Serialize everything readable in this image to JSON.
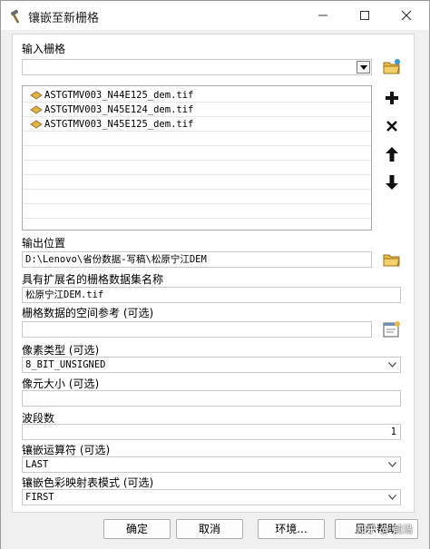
{
  "window": {
    "title": "镶嵌至新栅格",
    "minimize_symbol": "—",
    "maximize_symbol": "☐",
    "close_symbol": "✕"
  },
  "input_rasters": {
    "label": "输入栅格",
    "value": "",
    "items": [
      {
        "name": "ASTGTMV003_N44E125_dem.tif",
        "icon": "raster-layer-icon"
      },
      {
        "name": "ASTGTMV003_N45E124_dem.tif",
        "icon": "raster-layer-icon"
      },
      {
        "name": "ASTGTMV003_N45E125_dem.tif",
        "icon": "raster-layer-icon"
      }
    ]
  },
  "side_buttons": {
    "add": "+",
    "remove": "✕",
    "up": "↑",
    "down": "↓"
  },
  "output_location": {
    "label": "输出位置",
    "value": "D:\\Lenovo\\省份数据-写稿\\松原宁江DEM"
  },
  "output_name": {
    "label": "具有扩展名的栅格数据集名称",
    "value": "松原宁江DEM.tif"
  },
  "spatial_reference": {
    "label": "栅格数据的空间参考 (可选)",
    "value": ""
  },
  "pixel_type": {
    "label": "像素类型 (可选)",
    "value": "8_BIT_UNSIGNED"
  },
  "cellsize": {
    "label": "像元大小 (可选)",
    "value": ""
  },
  "bands": {
    "label": "波段数",
    "value": "1"
  },
  "mosaic_operator": {
    "label": "镶嵌运算符 (可选)",
    "value": "LAST"
  },
  "colormap_mode": {
    "label": "镶嵌色彩映射表模式 (可选)",
    "value": "FIRST"
  },
  "buttons": {
    "ok": "确定",
    "cancel": "取消",
    "environments": "环境...",
    "show_help": "显示帮助"
  },
  "watermark": "知乎 @ 前沿"
}
